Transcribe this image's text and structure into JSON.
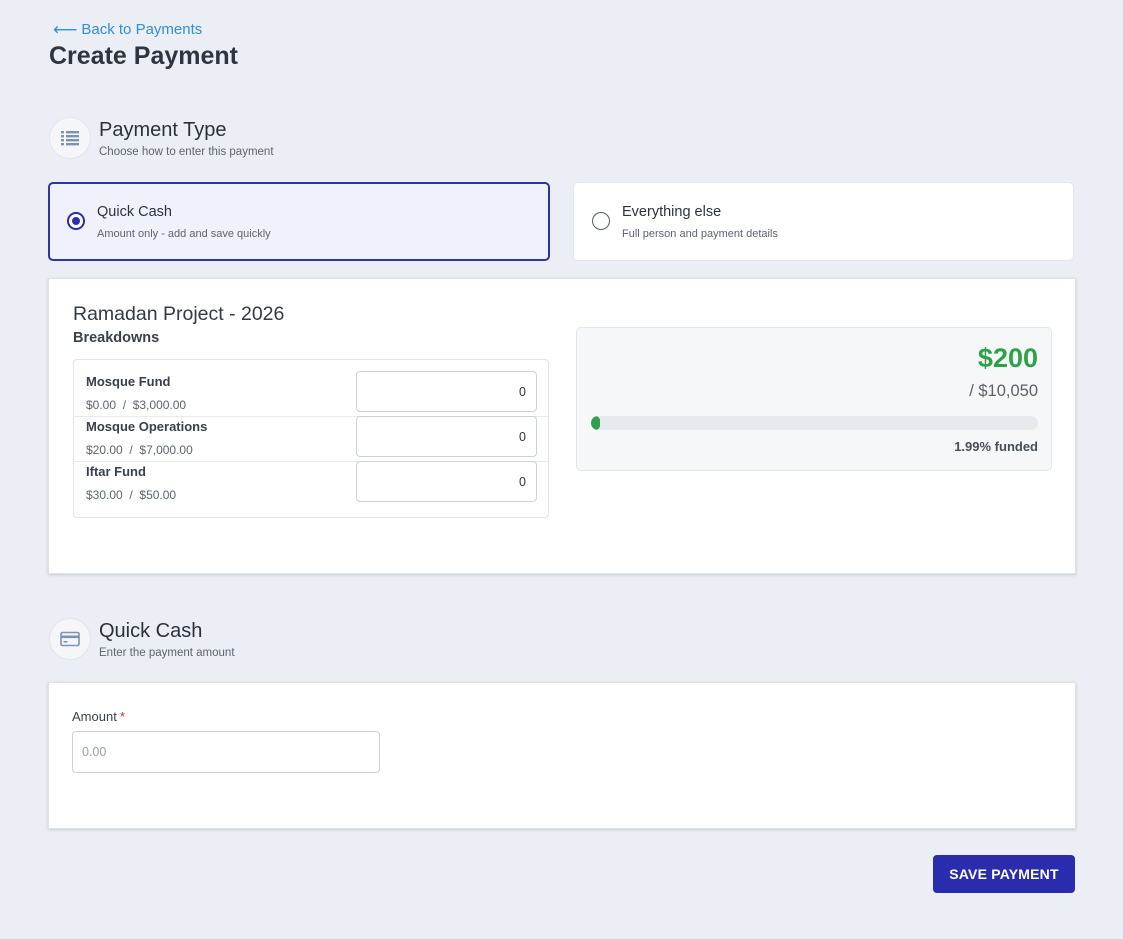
{
  "nav": {
    "back_label": "Back to Payments",
    "back_arrow": "⟵"
  },
  "page_title": "Create Payment",
  "payment_type": {
    "title": "Payment Type",
    "subtitle": "Choose how to enter this payment",
    "icon": "list-icon",
    "options": [
      {
        "title": "Quick Cash",
        "description": "Amount only - add and save quickly",
        "selected": true
      },
      {
        "title": "Everything else",
        "description": "Full person and payment details",
        "selected": false
      }
    ]
  },
  "project": {
    "title": "Ramadan Project - 2026",
    "breakdowns_label": "Breakdowns",
    "breakdowns": [
      {
        "name": "Mosque Fund",
        "raised": "$0.00",
        "separator": "/",
        "goal": "$3,000.00",
        "value": "0"
      },
      {
        "name": "Mosque Operations",
        "raised": "$20.00",
        "separator": "/",
        "goal": "$7,000.00",
        "value": "0"
      },
      {
        "name": "Iftar Fund",
        "raised": "$30.00",
        "separator": "/",
        "goal": "$50.00",
        "value": "0"
      }
    ],
    "raised": "$200",
    "goal": "/ $10,050",
    "funded_percent": 1.99,
    "funded_label": "1.99% funded"
  },
  "quick_cash": {
    "title": "Quick Cash",
    "subtitle": "Enter the payment amount",
    "icon": "credit-card-icon",
    "amount_label": "Amount",
    "required_mark": "*",
    "amount_placeholder": "0.00"
  },
  "save_label": "SAVE PAYMENT",
  "colors": {
    "primary": "#2a2cae",
    "success": "#2fa14a",
    "link": "#2f8fd8",
    "background": "#ebeef4"
  }
}
